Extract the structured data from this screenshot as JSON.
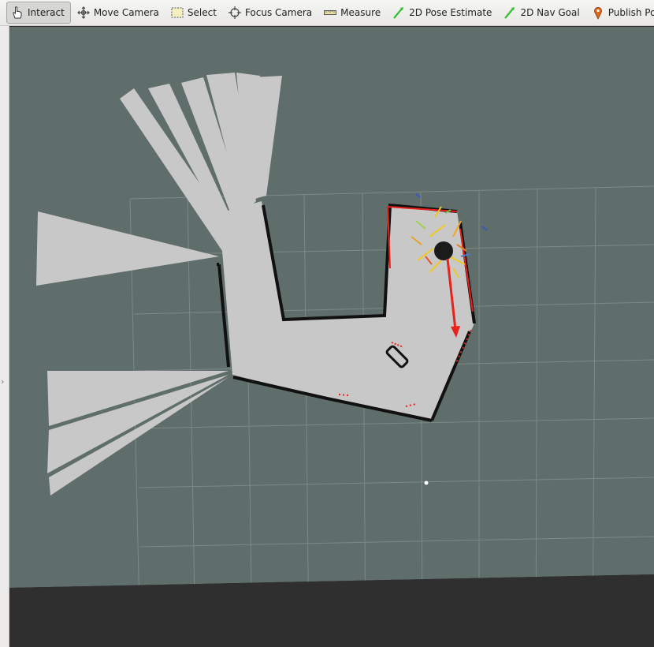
{
  "toolbar": {
    "tools": [
      {
        "label": "Interact",
        "icon": "hand-pointer-icon",
        "active": true
      },
      {
        "label": "Move Camera",
        "icon": "move-camera-icon",
        "active": false
      },
      {
        "label": "Select",
        "icon": "select-box-icon",
        "active": false
      },
      {
        "label": "Focus Camera",
        "icon": "focus-crosshair-icon",
        "active": false
      },
      {
        "label": "Measure",
        "icon": "ruler-icon",
        "active": false
      },
      {
        "label": "2D Pose Estimate",
        "icon": "green-arrow-icon",
        "active": false
      },
      {
        "label": "2D Nav Goal",
        "icon": "green-arrow-icon",
        "active": false
      },
      {
        "label": "Publish Point",
        "icon": "map-pin-icon",
        "active": false
      }
    ]
  },
  "viewport": {
    "background_color": "#5f6e6b",
    "map_free_color": "#c8c8c8",
    "map_wall_color": "#111111",
    "laser_color": "#e8211a",
    "particle_color": "#f2c81e",
    "robot_color": "#1b1b1b"
  }
}
